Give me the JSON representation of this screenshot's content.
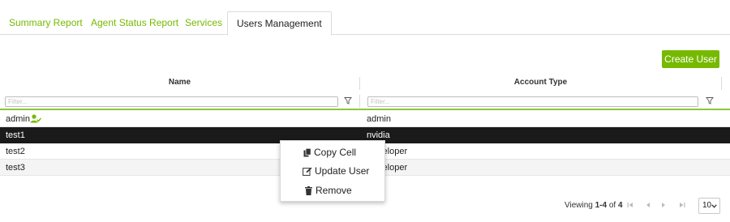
{
  "tabs": [
    {
      "label": "Summary Report",
      "active": false
    },
    {
      "label": "Agent Status Report",
      "active": false
    },
    {
      "label": "Services",
      "active": false
    },
    {
      "label": "Users Management",
      "active": true
    }
  ],
  "toolbar": {
    "create_user_label": "Create User"
  },
  "grid": {
    "columns": [
      "Name",
      "Account Type"
    ],
    "filter_placeholder": "Filter...",
    "rows": [
      {
        "name": "admin",
        "account_type": "admin",
        "is_current_user": true,
        "selected": false
      },
      {
        "name": "test1",
        "account_type": "nvidia",
        "is_current_user": false,
        "selected": true
      },
      {
        "name": "test2",
        "account_type": "Developer",
        "is_current_user": false,
        "selected": false
      },
      {
        "name": "test3",
        "account_type": "Developer",
        "is_current_user": false,
        "selected": false
      }
    ]
  },
  "context_menu": {
    "items": [
      {
        "label": "Copy Cell",
        "icon": "copy-icon"
      },
      {
        "label": "Update User",
        "icon": "edit-icon"
      },
      {
        "label": "Remove",
        "icon": "trash-icon"
      }
    ]
  },
  "pager": {
    "viewing_prefix": "Viewing ",
    "range": "1-4",
    "of_text": " of ",
    "total": "4",
    "page_size": "10"
  },
  "colors": {
    "accent": "#76b900",
    "selected_row": "#1a1a1a"
  }
}
